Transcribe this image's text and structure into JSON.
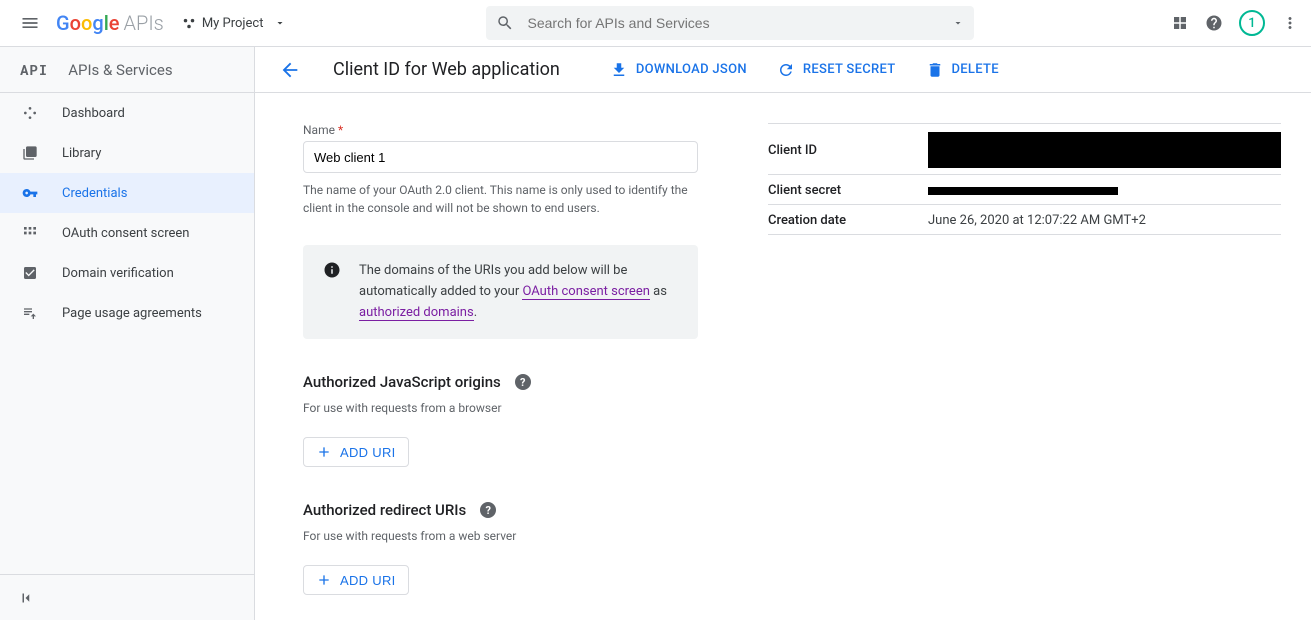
{
  "topbar": {
    "logo_suffix": "APIs",
    "project_name": "My Project",
    "search_placeholder": "Search for APIs and Services",
    "avatar_initial": "1"
  },
  "sidebar": {
    "badge": "API",
    "title": "APIs & Services",
    "items": [
      {
        "label": "Dashboard"
      },
      {
        "label": "Library"
      },
      {
        "label": "Credentials"
      },
      {
        "label": "OAuth consent screen"
      },
      {
        "label": "Domain verification"
      },
      {
        "label": "Page usage agreements"
      }
    ]
  },
  "toolbar": {
    "page_title": "Client ID for Web application",
    "download": "DOWNLOAD JSON",
    "reset": "RESET SECRET",
    "delete": "DELETE"
  },
  "form": {
    "name_label": "Name",
    "name_value": "Web client 1",
    "name_helper": "The name of your OAuth 2.0 client. This name is only used to identify the client in the console and will not be shown to end users.",
    "info_prefix": "The domains of the URIs you add below will be automatically added to your ",
    "info_link1": "OAuth consent screen",
    "info_mid": " as ",
    "info_link2": "authorized domains",
    "info_suffix": ".",
    "js_title": "Authorized JavaScript origins",
    "js_desc": "For use with requests from a browser",
    "redirect_title": "Authorized redirect URIs",
    "redirect_desc": "For use with requests from a web server",
    "add_uri": "ADD URI"
  },
  "details": {
    "client_id_label": "Client ID",
    "client_secret_label": "Client secret",
    "creation_label": "Creation date",
    "creation_value": "June 26, 2020 at 12:07:22 AM GMT+2"
  }
}
